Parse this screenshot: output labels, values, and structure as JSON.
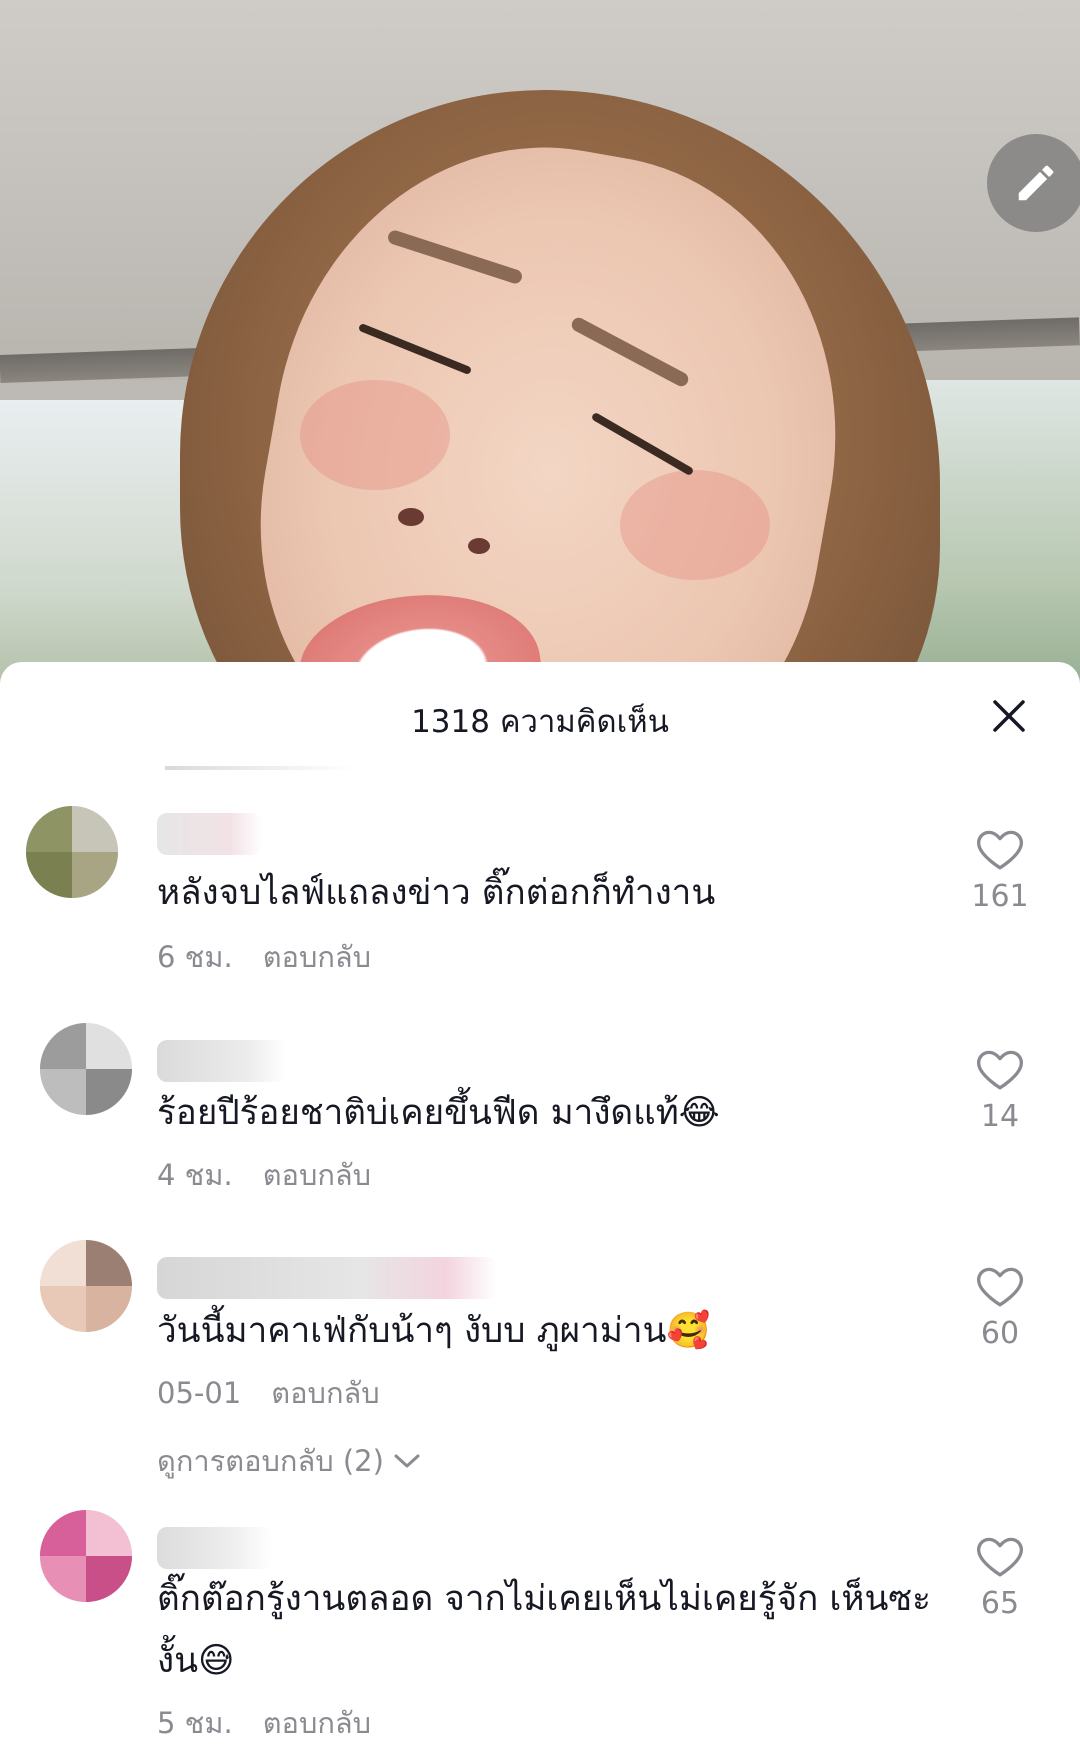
{
  "sheet": {
    "title": "1318 ความคิดเห็น"
  },
  "icons": {
    "edit": "pen-icon",
    "close": "close-icon",
    "like": "heart-outline-icon",
    "expand": "chevron-down-icon"
  },
  "colors": {
    "text_primary": "#161823",
    "text_secondary": "#8a8b91",
    "sheet_background": "#ffffff"
  },
  "comments": [
    {
      "text": "หลังจบไลฟ์แถลงข่าว ติ๊กต่อกก็ทำงาน",
      "time": "6 ชม.",
      "reply_label": "ตอบกลับ",
      "likes": "161"
    },
    {
      "text": "ร้อยปีร้อยชาติบ่เคยขึ้นฟีด มางึดแท้😂",
      "time": "4 ชม.",
      "reply_label": "ตอบกลับ",
      "likes": "14"
    },
    {
      "text": "วันนี้มาคาเฟ่กับน้าๆ งับบ ภูผาม่าน🥰",
      "time": "05-01",
      "reply_label": "ตอบกลับ",
      "likes": "60",
      "view_replies": "ดูการตอบกลับ (2)"
    },
    {
      "text": "ติ๊กต๊อกรู้งานตลอด จากไม่เคยเห็นไม่เคยรู้จัก เห็นซะงั้น😅",
      "time": "5 ชม.",
      "reply_label": "ตอบกลับ",
      "likes": "65"
    }
  ]
}
